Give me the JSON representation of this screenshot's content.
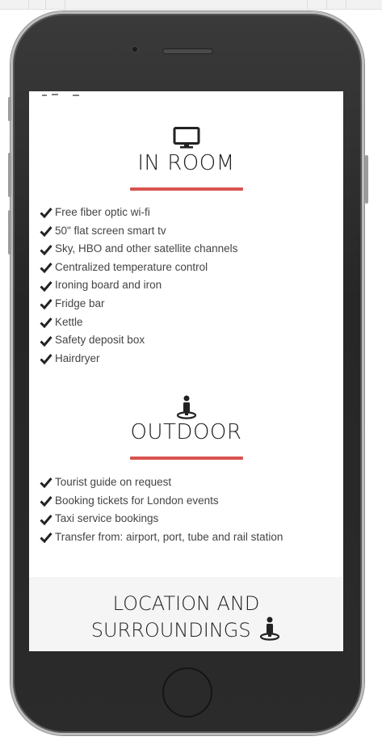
{
  "in_room": {
    "icon": "monitor-icon",
    "title": "IN ROOM",
    "items": [
      "Free fiber optic wi-fi",
      "50\" flat screen smart tv",
      "Sky, HBO and other satellite channels",
      "Centralized temperature control",
      "Ironing board and iron",
      "Fridge bar",
      "Kettle",
      "Safety deposit box",
      "Hairdryer"
    ]
  },
  "outdoor": {
    "icon": "person-location-icon",
    "title": "OUTDOOR",
    "items": [
      "Tourist guide on request",
      "Booking tickets for London events",
      "Taxi service bookings",
      "Transfer from: airport, port, tube and rail station"
    ]
  },
  "location": {
    "title_line1": "LOCATION AND",
    "title_line2": "SURROUNDINGS",
    "icon": "person-location-icon"
  },
  "colors": {
    "accent": "#d9534f",
    "phone_body": "#2b2b2b",
    "text": "#444444"
  }
}
